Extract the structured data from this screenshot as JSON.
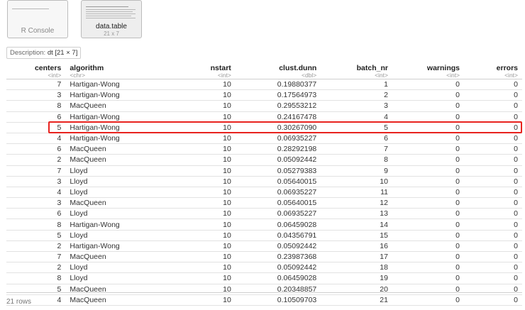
{
  "tabs": [
    {
      "label": "R Console",
      "sub": ""
    },
    {
      "label": "data.table",
      "sub": "21 x 7"
    }
  ],
  "description": {
    "label": "Description:",
    "value": "dt [21 × 7]"
  },
  "columns": [
    {
      "name": "centers",
      "type": "<int>",
      "cls": "c-centers"
    },
    {
      "name": "algorithm",
      "type": "<chr>",
      "cls": "c-algorithm"
    },
    {
      "name": "nstart",
      "type": "<int>",
      "cls": "c-nstart"
    },
    {
      "name": "clust.dunn",
      "type": "<dbl>",
      "cls": "c-dunn"
    },
    {
      "name": "batch_nr",
      "type": "<int>",
      "cls": "c-batch"
    },
    {
      "name": "warnings",
      "type": "<int>",
      "cls": "c-warn"
    },
    {
      "name": "errors",
      "type": "<int>",
      "cls": "c-err"
    }
  ],
  "rows": [
    [
      "7",
      "Hartigan-Wong",
      "10",
      "0.19880377",
      "1",
      "0",
      "0"
    ],
    [
      "3",
      "Hartigan-Wong",
      "10",
      "0.17564973",
      "2",
      "0",
      "0"
    ],
    [
      "8",
      "MacQueen",
      "10",
      "0.29553212",
      "3",
      "0",
      "0"
    ],
    [
      "6",
      "Hartigan-Wong",
      "10",
      "0.24167478",
      "4",
      "0",
      "0"
    ],
    [
      "5",
      "Hartigan-Wong",
      "10",
      "0.30267090",
      "5",
      "0",
      "0"
    ],
    [
      "4",
      "Hartigan-Wong",
      "10",
      "0.06935227",
      "6",
      "0",
      "0"
    ],
    [
      "6",
      "MacQueen",
      "10",
      "0.28292198",
      "7",
      "0",
      "0"
    ],
    [
      "2",
      "MacQueen",
      "10",
      "0.05092442",
      "8",
      "0",
      "0"
    ],
    [
      "7",
      "Lloyd",
      "10",
      "0.05279383",
      "9",
      "0",
      "0"
    ],
    [
      "3",
      "Lloyd",
      "10",
      "0.05640015",
      "10",
      "0",
      "0"
    ],
    [
      "4",
      "Lloyd",
      "10",
      "0.06935227",
      "11",
      "0",
      "0"
    ],
    [
      "3",
      "MacQueen",
      "10",
      "0.05640015",
      "12",
      "0",
      "0"
    ],
    [
      "6",
      "Lloyd",
      "10",
      "0.06935227",
      "13",
      "0",
      "0"
    ],
    [
      "8",
      "Hartigan-Wong",
      "10",
      "0.06459028",
      "14",
      "0",
      "0"
    ],
    [
      "5",
      "Lloyd",
      "10",
      "0.04356791",
      "15",
      "0",
      "0"
    ],
    [
      "2",
      "Hartigan-Wong",
      "10",
      "0.05092442",
      "16",
      "0",
      "0"
    ],
    [
      "7",
      "MacQueen",
      "10",
      "0.23987368",
      "17",
      "0",
      "0"
    ],
    [
      "2",
      "Lloyd",
      "10",
      "0.05092442",
      "18",
      "0",
      "0"
    ],
    [
      "8",
      "Lloyd",
      "10",
      "0.06459028",
      "19",
      "0",
      "0"
    ],
    [
      "5",
      "MacQueen",
      "10",
      "0.20348857",
      "20",
      "0",
      "0"
    ],
    [
      "4",
      "MacQueen",
      "10",
      "0.10509703",
      "21",
      "0",
      "0"
    ]
  ],
  "highlighted_row_index": 4,
  "highlight_color": "#e8231f",
  "footer": {
    "rows_label": "21 rows"
  }
}
